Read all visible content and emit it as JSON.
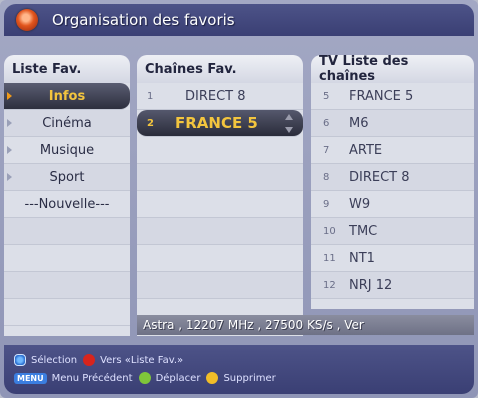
{
  "title": "Organisation des favoris",
  "left": {
    "header": "Liste Fav.",
    "items": [
      {
        "label": "Infos",
        "selected": true
      },
      {
        "label": "Cinéma"
      },
      {
        "label": "Musique"
      },
      {
        "label": "Sport"
      },
      {
        "label": "---Nouvelle---"
      }
    ]
  },
  "middle": {
    "header": "Chaînes Fav.",
    "items": [
      {
        "num": "1",
        "name": "DIRECT 8"
      },
      {
        "num": "2",
        "name": "FRANCE 5",
        "selected": true
      }
    ]
  },
  "right": {
    "header": "TV Liste des chaînes",
    "items": [
      {
        "num": "5",
        "name": "FRANCE 5"
      },
      {
        "num": "6",
        "name": "M6"
      },
      {
        "num": "7",
        "name": "ARTE"
      },
      {
        "num": "8",
        "name": "DIRECT 8"
      },
      {
        "num": "9",
        "name": "W9"
      },
      {
        "num": "10",
        "name": "TMC"
      },
      {
        "num": "11",
        "name": "NT1"
      },
      {
        "num": "12",
        "name": "NRJ 12"
      }
    ]
  },
  "info": "Astra , 12207 MHz , 27500 KS/s , Ver",
  "help": {
    "select": "Sélection",
    "to_list": "Vers «Liste Fav.»",
    "menu_key": "MENU",
    "previous": "Menu Précédent",
    "move": "Déplacer",
    "delete": "Supprimer"
  },
  "colors": {
    "title_bar": "#444a80",
    "selected_text": "#f3c53e",
    "red_key": "#d8241c",
    "green_key": "#7fc53a",
    "yellow_key": "#f2bd28"
  }
}
